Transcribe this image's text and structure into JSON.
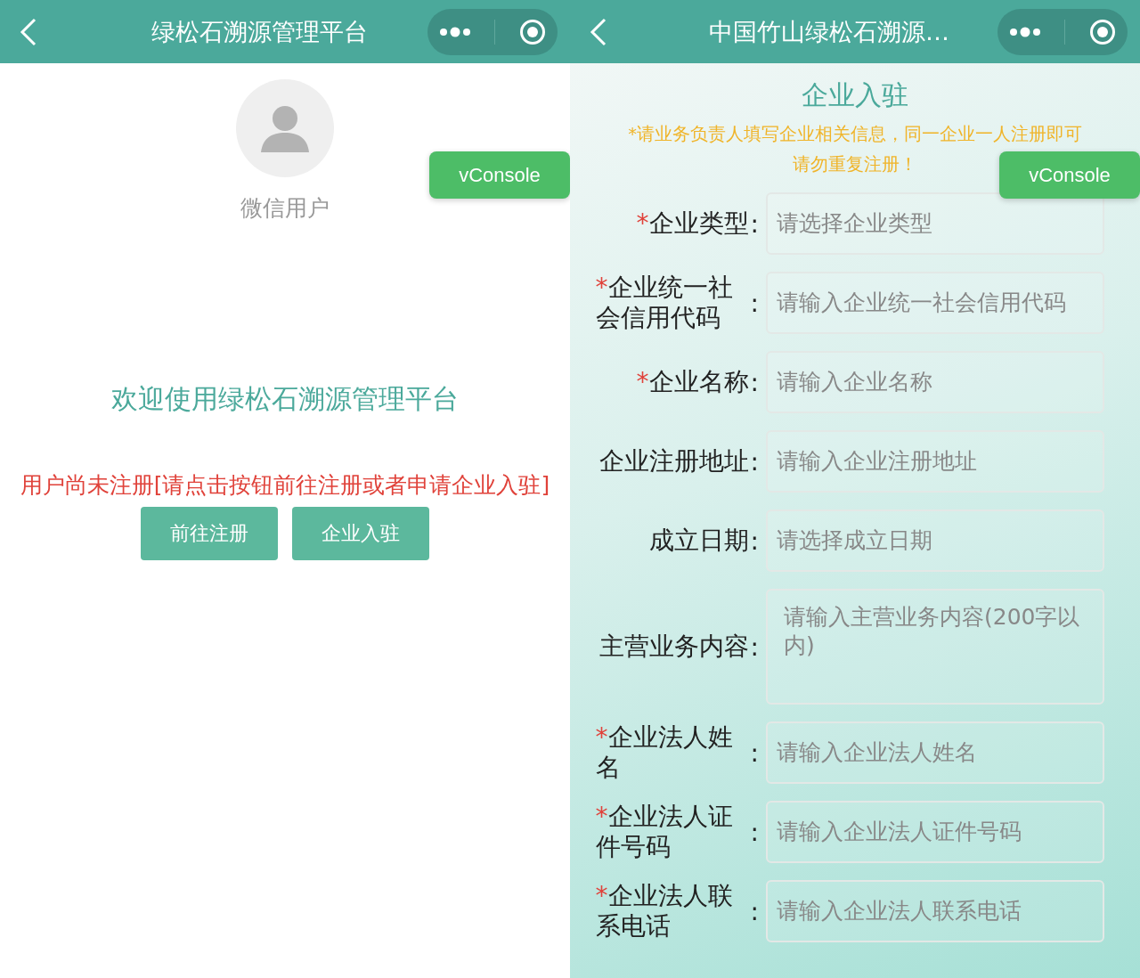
{
  "screens": [
    {
      "kind": "welcome",
      "title": "绿松石溯源管理平台",
      "user_name": "微信用户",
      "welcome": "欢迎使用绿松石溯源管理平台",
      "notice": "用户尚未注册[请点击按钮前往注册或者申请企业入驻]",
      "buttons": [
        "前往注册",
        "企业入驻"
      ],
      "debug_button": "vConsole"
    },
    {
      "kind": "form",
      "title": "中国竹山绿松石溯源…",
      "heading": "企业入驻",
      "notice_lines": [
        "*请业务负责人填写企业相关信息，同一企业一人注册即可",
        "请勿重复注册！"
      ],
      "debug_button": "vConsole",
      "fields": [
        {
          "required_mark": "*",
          "label": "企业类型",
          "colon": ":",
          "placeholder": "请选择企业类型",
          "kind": "select"
        },
        {
          "required_mark": "*",
          "label": "企业统一社会信用代码",
          "colon": ":",
          "placeholder": "请输入企业统一社会信用代码",
          "kind": "input"
        },
        {
          "required_mark": "*",
          "label": "企业名称",
          "colon": ":",
          "placeholder": "请输入企业名称",
          "kind": "input"
        },
        {
          "label": "企业注册地址",
          "colon": ":",
          "placeholder": "请输入企业注册地址",
          "kind": "input"
        },
        {
          "label": "成立日期",
          "colon": ":",
          "placeholder": "请选择成立日期",
          "kind": "select"
        },
        {
          "label": "主营业务内容",
          "colon": ":",
          "placeholder": "请输入主营业务内容(200字以内)",
          "kind": "textarea"
        },
        {
          "required_mark": "*",
          "label": "企业法人姓名",
          "colon": ":",
          "placeholder": "请输入企业法人姓名",
          "kind": "input"
        },
        {
          "required_mark": "*",
          "label": "企业法人证件号码",
          "colon": ":",
          "placeholder": "请输入企业法人证件号码",
          "kind": "input"
        },
        {
          "required_mark": "*",
          "label": "企业法人联系电话",
          "colon": ":",
          "placeholder": "请输入企业法人联系电话",
          "kind": "input"
        }
      ]
    }
  ]
}
